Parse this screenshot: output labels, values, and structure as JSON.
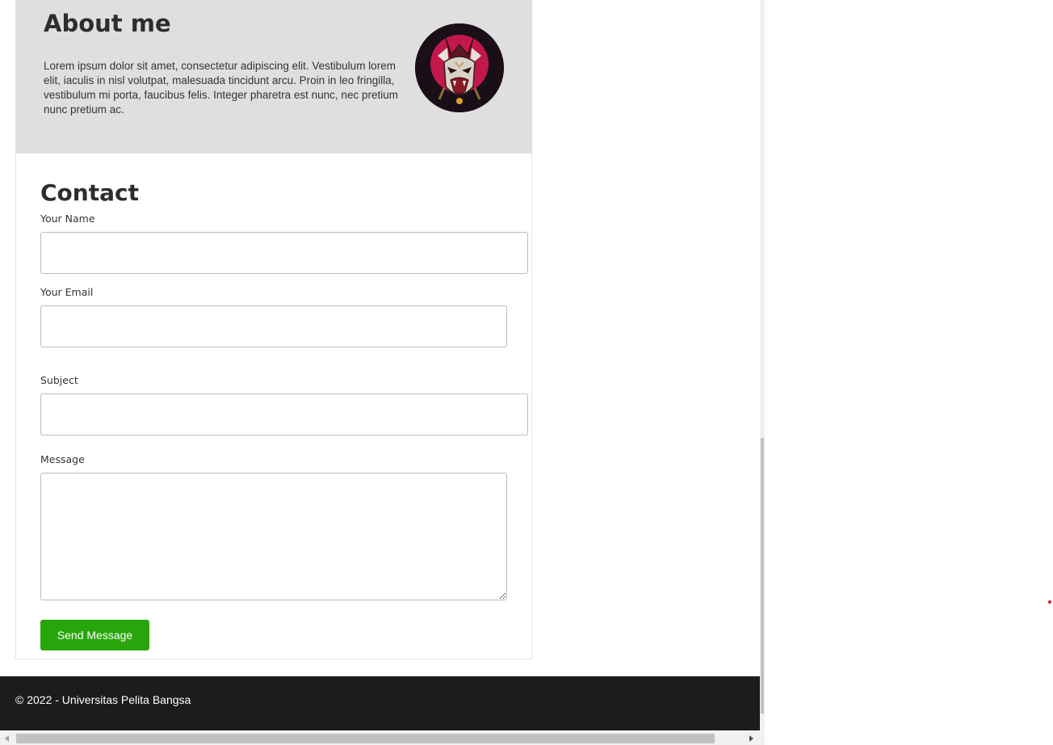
{
  "about": {
    "title": "About me",
    "text": "Lorem ipsum dolor sit amet, consectetur adipiscing elit. Vestibulum lorem elit, iaculis in nisl volutpat, malesuada tincidunt arcu. Proin in leo fringilla, vestibulum mi porta, faucibus felis. Integer pharetra est nunc, nec pretium nunc pretium ac.",
    "avatar_icon": "samurai-tiger-mask-icon"
  },
  "contact": {
    "title": "Contact",
    "name_label": "Your Name",
    "name_value": "",
    "email_label": "Your Email",
    "email_value": "",
    "subject_label": "Subject",
    "subject_value": "",
    "message_label": "Message",
    "message_value": "",
    "send_label": "Send Message"
  },
  "footer": {
    "copyright": "© 2022 - Universitas Pelita Bangsa"
  },
  "colors": {
    "about_bg": "#e0dfdf",
    "button_green": "#28a50b",
    "footer_bg": "#1c1c1c",
    "avatar_accent": "#c3184b"
  }
}
